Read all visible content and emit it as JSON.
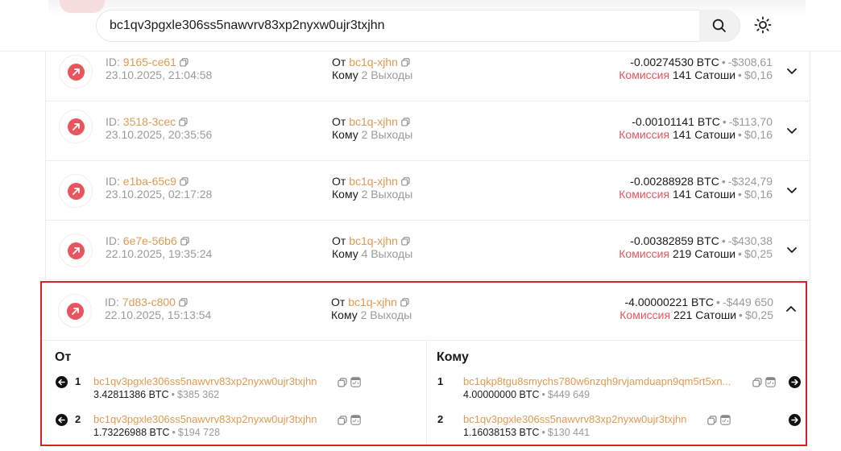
{
  "search": {
    "value": "bc1qv3pgxle306ss5nawvrv83xp2nyxw0ujr3txjhn"
  },
  "labels": {
    "id_prefix": "ID: ",
    "from": "От",
    "to": "Кому",
    "fee": "Комиссия",
    "sat": "Сатоши",
    "btc": "BTC",
    "bullet": "•"
  },
  "transactions": [
    {
      "id": "9165-ce61",
      "date": "23.10.2025, 21:04:58",
      "from_addr": "bc1q-xjhn",
      "to_count": "2 Выходы",
      "amount": "-0.00274530 BTC",
      "usd": "-$308,61",
      "fee_sat": "141",
      "fee_usd": "$0,16"
    },
    {
      "id": "3518-3cec",
      "date": "23.10.2025, 20:35:56",
      "from_addr": "bc1q-xjhn",
      "to_count": "2 Выходы",
      "amount": "-0.00101141 BTC",
      "usd": "-$113,70",
      "fee_sat": "141",
      "fee_usd": "$0,16"
    },
    {
      "id": "e1ba-65c9",
      "date": "23.10.2025, 02:17:28",
      "from_addr": "bc1q-xjhn",
      "to_count": "2 Выходы",
      "amount": "-0.00288928 BTC",
      "usd": "-$324,79",
      "fee_sat": "141",
      "fee_usd": "$0,16"
    },
    {
      "id": "6e7e-56b6",
      "date": "22.10.2025, 19:35:24",
      "from_addr": "bc1q-xjhn",
      "to_count": "4 Выходы",
      "amount": "-0.00382859 BTC",
      "usd": "-$430,38",
      "fee_sat": "219",
      "fee_usd": "$0,25"
    }
  ],
  "expanded": {
    "id": "7d83-c800",
    "date": "22.10.2025, 15:13:54",
    "from_addr": "bc1q-xjhn",
    "to_count": "2 Выходы",
    "amount": "-4.00000221 BTC",
    "usd": "-$449 650",
    "fee_sat": "221",
    "fee_usd": "$0,25",
    "inputs": [
      {
        "n": "1",
        "addr": "bc1qv3pgxle306ss5nawvrv83xp2nyxw0ujr3txjhn",
        "btc": "3.42811386 BTC",
        "usd": "$385 362"
      },
      {
        "n": "2",
        "addr": "bc1qv3pgxle306ss5nawvrv83xp2nyxw0ujr3txjhn",
        "btc": "1.73226988 BTC",
        "usd": "$194 728"
      }
    ],
    "outputs": [
      {
        "n": "1",
        "addr": "bc1qkp8tgu8smychs780w6nzqh9rvjamduapn9qm5rt5xn...",
        "btc": "4.00000000 BTC",
        "usd": "$449 649"
      },
      {
        "n": "2",
        "addr": "bc1qv3pgxle306ss5nawvrv83xp2nyxw0ujr3txjhn",
        "btc": "1.16038153 BTC",
        "usd": "$130 441"
      }
    ]
  },
  "colors": {
    "accent": "#e09a52",
    "outgoing": "#e8555f",
    "highlight_border": "#d9232b"
  },
  "icons": [
    "search-icon",
    "sun-icon",
    "outgoing-arrow-icon",
    "copy-icon",
    "chevron-down-icon",
    "chevron-up-icon",
    "explorer-icon",
    "arrow-left-icon",
    "arrow-right-icon"
  ]
}
